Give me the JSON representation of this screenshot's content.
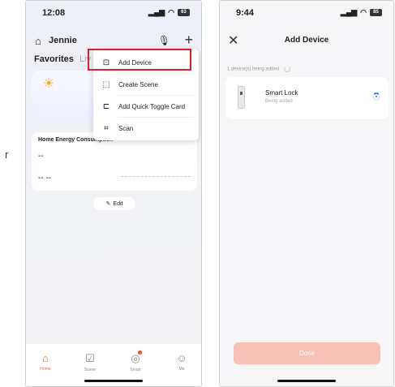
{
  "stray_text": "r",
  "phone1": {
    "status": {
      "time": "12:08",
      "battery": "63"
    },
    "home_name": "Jennie",
    "tabs": {
      "favorites": "Favorites",
      "second": "Liv"
    },
    "menu": {
      "items": [
        {
          "label": "Add Device",
          "icon": "add-device-icon"
        },
        {
          "label": "Create Scene",
          "icon": "create-scene-icon"
        },
        {
          "label": "Add Quick Toggle Card",
          "icon": "quick-toggle-icon"
        },
        {
          "label": "Scan",
          "icon": "scan-icon"
        }
      ]
    },
    "energy": {
      "title": "Home Energy Consumption",
      "value1": "--",
      "value2": "-- --"
    },
    "edit_label": "Edit",
    "nav": [
      {
        "label": "Home",
        "active": true
      },
      {
        "label": "Scene",
        "active": false
      },
      {
        "label": "Smart",
        "active": false
      },
      {
        "label": "Me",
        "active": false
      }
    ],
    "colors": {
      "accent": "#f06a1a",
      "highlight": "#d8202f"
    }
  },
  "phone2": {
    "status": {
      "time": "9:44",
      "battery": "85"
    },
    "title": "Add Device",
    "added_count": "1 device(s) being added",
    "device": {
      "name": "Smart Lock",
      "status": "Being added"
    },
    "done_label": "Done",
    "colors": {
      "spinner": "#2f7df6",
      "done_bg": "#f7c1b5"
    }
  }
}
